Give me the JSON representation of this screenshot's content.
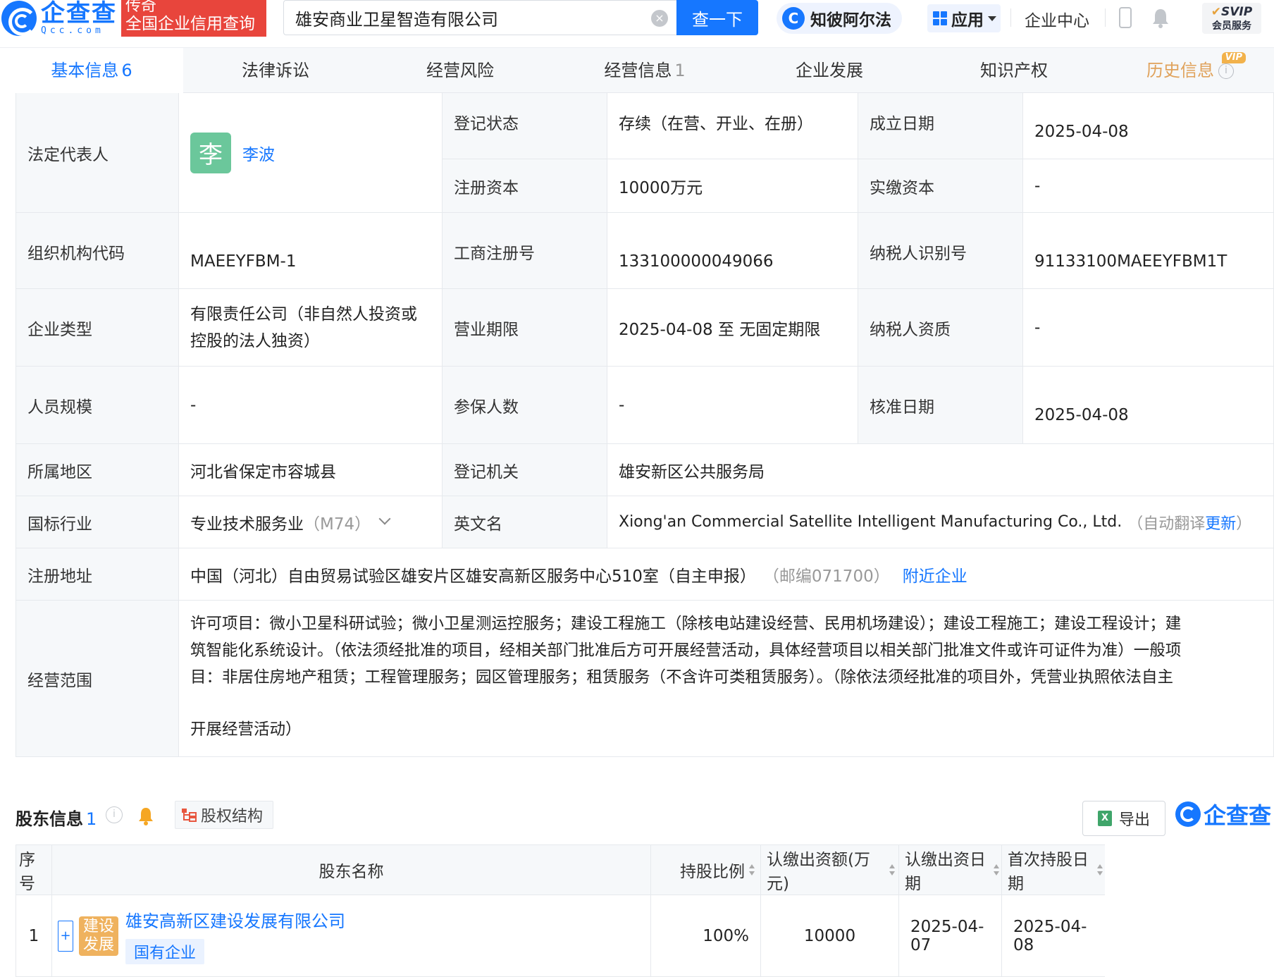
{
  "header": {
    "logo_cn": "企查查",
    "logo_en": "Qcc.com",
    "promo_line1": "传奇",
    "promo_line2": "全国企业信用查询",
    "search_value": "雄安商业卫星智造有限公司",
    "search_button": "查一下",
    "ai_label": "知彼阿尔法",
    "apps_label": "应用",
    "enterprise_center": "企业中心",
    "svip_line1": "SVIP",
    "svip_line2": "会员服务",
    "brand_color": "#1677ff"
  },
  "tabs": [
    {
      "label": "基本信息",
      "count": "6"
    },
    {
      "label": "法律诉讼",
      "count": ""
    },
    {
      "label": "经营风险",
      "count": ""
    },
    {
      "label": "经营信息",
      "count": "1"
    },
    {
      "label": "企业发展",
      "count": ""
    },
    {
      "label": "知识产权",
      "count": ""
    },
    {
      "label": "历史信息",
      "count": "",
      "badge": "VIP"
    }
  ],
  "info": {
    "legal_rep_label": "法定代表人",
    "legal_rep_avatar": "李",
    "legal_rep_name": "李波",
    "reg_status_label": "登记状态",
    "reg_status": "存续（在营、开业、在册）",
    "est_date_label": "成立日期",
    "est_date": "2025-04-08",
    "reg_capital_label": "注册资本",
    "reg_capital": "10000万元",
    "paid_capital_label": "实缴资本",
    "paid_capital": "-",
    "org_code_label": "组织机构代码",
    "org_code": "MAEEYFBM-1",
    "biz_reg_no_label": "工商注册号",
    "biz_reg_no": "133100000049066",
    "tax_id_label": "纳税人识别号",
    "tax_id": "91133100MAEEYFBM1T",
    "company_type_label": "企业类型",
    "company_type": "有限责任公司（非自然人投资或控股的法人独资）",
    "biz_term_label": "营业期限",
    "biz_term": "2025-04-08 至 无固定期限",
    "taxpayer_qual_label": "纳税人资质",
    "taxpayer_qual": "-",
    "staff_size_label": "人员规模",
    "staff_size": "-",
    "insured_label": "参保人数",
    "insured": "-",
    "approval_date_label": "核准日期",
    "approval_date": "2025-04-08",
    "region_label": "所属地区",
    "region": "河北省保定市容城县",
    "reg_authority_label": "登记机关",
    "reg_authority": "雄安新区公共服务局",
    "industry_label": "国标行业",
    "industry": "专业技术服务业",
    "industry_code": "（M74）",
    "english_name_label": "英文名",
    "english_name": "Xiong'an Commercial Satellite Intelligent Manufacturing Co., Ltd.",
    "auto_translate": "（自动翻译",
    "update_link": "更新",
    "auto_translate_end": "）",
    "address_label": "注册地址",
    "address": "中国（河北）自由贸易试验区雄安片区雄安高新区服务中心510室（自主申报）",
    "postcode": "（邮编071700）",
    "nearby_link": "附近企业",
    "scope_label": "经营范围",
    "scope_line1": "许可项目：微小卫星科研试验；微小卫星测运控服务；建设工程施工（除核电站建设经营、民用机场建设）；建设工程施工；建设工程设计；建",
    "scope_line2": "筑智能化系统设计。（依法须经批准的项目，经相关部门批准后方可开展经营活动，具体经营项目以相关部门批准文件或许可证件为准）一般项",
    "scope_line3": "目：非居住房地产租赁；工程管理服务；园区管理服务；租赁服务（不含许可类租赁服务）。（除依法须经批准的项目外，凭营业执照依法自主",
    "scope_line4": "开展经营活动）"
  },
  "shareholders": {
    "title": "股东信息",
    "count": "1",
    "equity_button": "股权结构",
    "export_button": "导出",
    "watermark": "企查查",
    "columns": [
      "序号",
      "股东名称",
      "持股比例",
      "认缴出资额(万元)",
      "认缴出资日期",
      "首次持股日期"
    ],
    "rows": [
      {
        "index": "1",
        "logo_text": "建设发展",
        "name": "雄安高新区建设发展有限公司",
        "tag": "国有企业",
        "ratio": "100%",
        "amount": "10000",
        "subscribe_date": "2025-04-07",
        "first_hold_date": "2025-04-08"
      }
    ]
  }
}
